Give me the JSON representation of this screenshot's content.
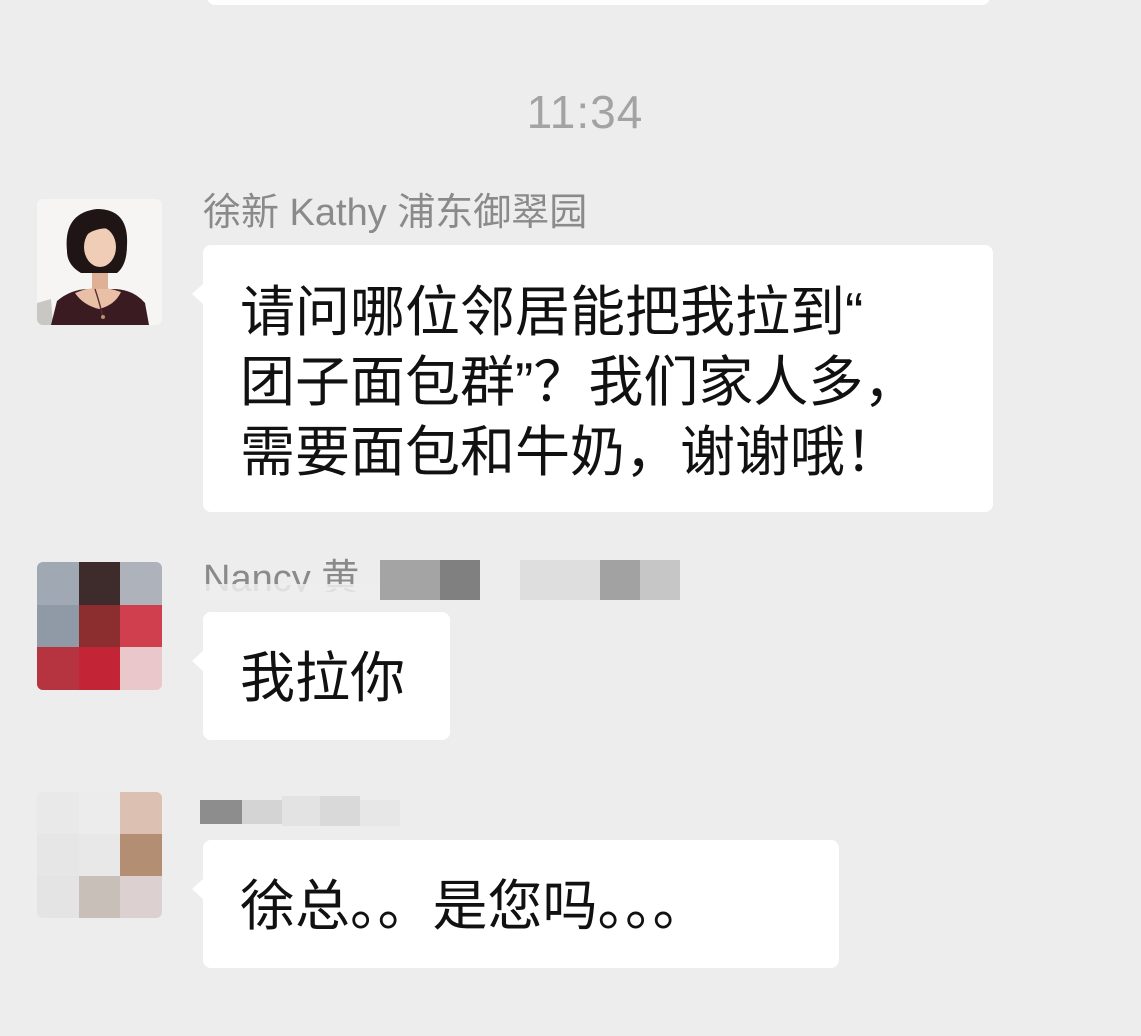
{
  "timestamp": "11:34",
  "messages": [
    {
      "sender": "徐新 Kathy 浦东御翠园",
      "avatar": "woman-portrait-avatar",
      "lines": [
        "请问哪位邻居能把我拉到“",
        "团子面包群”？我们家人多，",
        "需要面包和牛奶，谢谢哦！"
      ]
    },
    {
      "sender": "Nancy 黄",
      "avatar": "pixelated-avatar",
      "avatar_mosaic": [
        "#a0a9b3",
        "#3e2c2c",
        "#aeb2bb",
        "#8f9aa6",
        "#8c2d2f",
        "#cf3f4e",
        "#b5343f",
        "#c42536",
        "#e9c7cb"
      ],
      "lines": [
        "我拉你"
      ]
    },
    {
      "avatar": "pixelated-avatar",
      "avatar_mosaic": [
        "#e9e9e9",
        "#ececec",
        "#dcc0b2",
        "#e6e6e6",
        "#e8e8e8",
        "#b48e72",
        "#e4e4e4",
        "#c7bfb8",
        "#ddd0d0"
      ],
      "lines": [
        "徐总。。是您吗。。。"
      ]
    }
  ],
  "colors": {
    "background": "#ededed",
    "bubble": "#ffffff",
    "timestamp": "#a3a3a3",
    "sender_name": "#8a8a8a",
    "message_text": "#111111"
  }
}
